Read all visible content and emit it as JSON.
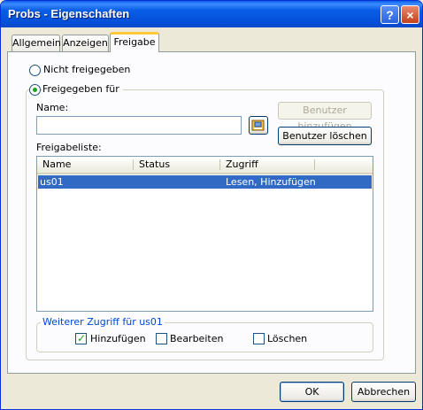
{
  "window": {
    "title": "Probs - Eigenschaften",
    "help_label": "?",
    "close_label": "×"
  },
  "tabs": [
    {
      "label": "Allgemein",
      "active": false
    },
    {
      "label": "Anzeigen",
      "active": false
    },
    {
      "label": "Freigabe",
      "active": true
    }
  ],
  "sharing": {
    "not_shared_label": "Nicht freigegeben",
    "shared_for_label": "Freigegeben für",
    "selected_option": "shared_for",
    "name_label": "Name:",
    "name_value": "",
    "add_user_button": "Benutzer hinzufügen",
    "delete_user_button": "Benutzer löschen",
    "sharelist_label": "Freigabeliste:",
    "columns": [
      "Name",
      "Status",
      "Zugriff"
    ],
    "rows": [
      {
        "name": "us01",
        "status": "",
        "access": "Lesen, Hinzufügen",
        "selected": true
      }
    ]
  },
  "access_group": {
    "title": "Weiterer Zugriff für us01",
    "options": [
      {
        "label": "Hinzufügen",
        "checked": true
      },
      {
        "label": "Bearbeiten",
        "checked": false
      },
      {
        "label": "Löschen",
        "checked": false
      }
    ]
  },
  "footer": {
    "ok_label": "OK",
    "cancel_label": "Abbrechen"
  },
  "colors": {
    "titlebar": "#0a5ee6",
    "selection": "#316ac5",
    "check_green": "#21a121",
    "group_title": "#0046d5"
  }
}
